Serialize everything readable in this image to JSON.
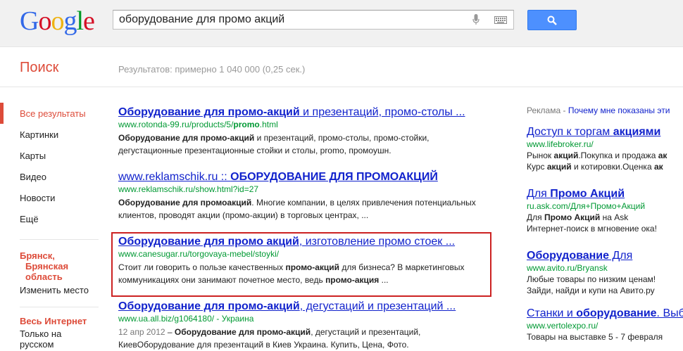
{
  "logo": "Google",
  "search": {
    "value": "оборудование для промо акций"
  },
  "section_title": "Поиск",
  "stats": "Результатов: примерно 1 040 000 (0,25 сек.)",
  "nav": {
    "items": [
      "Все результаты",
      "Картинки",
      "Карты",
      "Видео",
      "Новости",
      "Ещё"
    ],
    "location_line1": "Брянск,",
    "location_line2": "Брянская",
    "location_line3": "область",
    "change_location": "Изменить место",
    "scope_title": "Весь Интернет",
    "scope_line1": "Только на",
    "scope_line2": "русском"
  },
  "results": [
    {
      "title_bold": "Оборудование для промо-акций",
      "title_rest": " и презентаций, промо-столы ...",
      "url_pre": "www.rotonda-99.ru/products/5/",
      "url_bold": "promo",
      "url_post": ".html",
      "snip_bold": "Оборудование для промо-акций",
      "snip_rest": " и презентаций, промо-столы, промо-стойки, дегустационные презентационные стойки и столы, promo, промоушн."
    },
    {
      "title_pre": "www.reklamschik.ru :: ",
      "title_bold": "ОБОРУДОВАНИЕ ДЛЯ ПРОМОАКЦИЙ",
      "url": "www.reklamschik.ru/show.html?id=27",
      "snip_bold": "Оборудование для промоакций",
      "snip_rest": ". Многие компании, в целях привлечения потенциальных клиентов, проводят акции (промо-акции) в торговых центрах, ..."
    },
    {
      "title_bold": "Оборудование для промо акций",
      "title_rest": ", изготовление промо стоек ...",
      "url": "www.canesugar.ru/torgovaya-mebel/stoyki/",
      "snip_pre": "Стоит ли говорить о пользе качественных ",
      "snip_bold": "промо-акций",
      "snip_mid": " для бизнеса? В маркетинговых коммуникациях они занимают почетное место, ведь ",
      "snip_bold2": "промо-акция",
      "snip_end": " ..."
    },
    {
      "title_bold": "Оборудование для промо-акций",
      "title_rest": ", дегустаций и презентаций ...",
      "url": "www.ua.all.biz/g1064180/ - Украина",
      "date": "12 апр 2012",
      "snip_bold": "Оборудование для промо-акций",
      "snip_rest": ", дегустаций и презентаций, КиевОборудование для презентаций в Киев Украина. Купить, Цена, Фото."
    }
  ],
  "ads": {
    "label_pre": "Реклама - ",
    "label_link": "Почему мне показаны эти",
    "items": [
      {
        "title_pre": "Доступ к торгам ",
        "title_bold": "акциями",
        "url": "www.lifebroker.ru/",
        "line1_pre": "Рынок ",
        "line1_bold": "акций",
        "line1_post": ".Покупка и продажа ",
        "line1_bold2": "ак",
        "line2_pre": "Курс ",
        "line2_bold": "акций",
        "line2_post": " и котировки.Оценка ",
        "line2_bold2": "ак"
      },
      {
        "title_pre": "Для ",
        "title_bold": "Промо Акций",
        "url": "ru.ask.com/Для+Промо+Акций",
        "line1_pre": "Для ",
        "line1_bold": "Промо Акций",
        "line1_post": " на Ask",
        "line2": "Интернет-поиск в мгновение ока!"
      },
      {
        "title_bold": "Оборудование",
        "title_post": " Для",
        "url": "www.avito.ru/Bryansk",
        "line1": "Любые товары по низким ценам!",
        "line2": "Зайди, найди и купи на Авито.ру"
      },
      {
        "title_pre": "Станки и ",
        "title_bold": "оборудование",
        "title_post": ".",
        "title_link2": "Выб",
        "url": "www.vertolexpo.ru/",
        "line1": "Товары на выставке 5 - 7 февраля"
      }
    ]
  }
}
